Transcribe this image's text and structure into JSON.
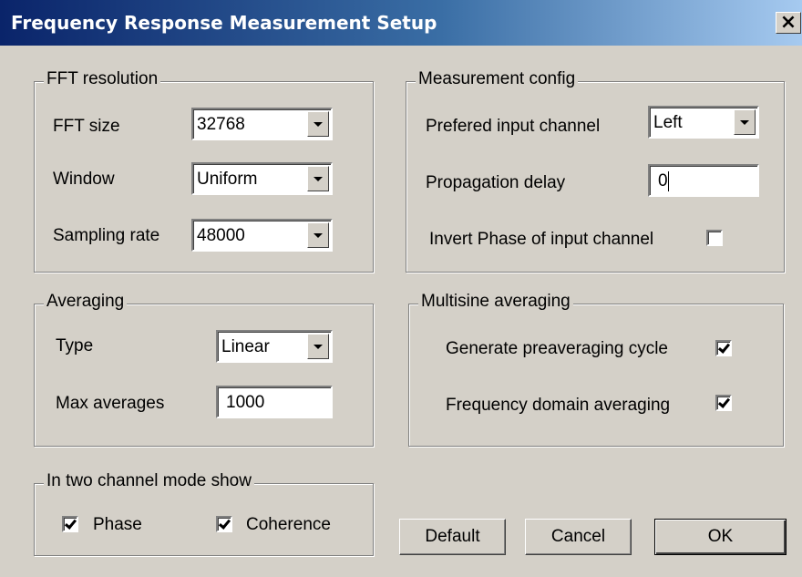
{
  "window": {
    "title": "Frequency Response Measurement Setup",
    "close_label": "×"
  },
  "fft": {
    "title": "FFT resolution",
    "fft_size_label": "FFT size",
    "fft_size_value": "32768",
    "window_label": "Window",
    "window_value": "Uniform",
    "sampling_label": "Sampling rate",
    "sampling_value": "48000"
  },
  "measurement": {
    "title": "Measurement config",
    "channel_label": "Prefered input channel",
    "channel_value": "Left",
    "delay_label": "Propagation delay",
    "delay_value": "0",
    "invert_label": "Invert Phase of input channel",
    "invert_checked": false
  },
  "averaging": {
    "title": "Averaging",
    "type_label": "Type",
    "type_value": "Linear",
    "max_label": "Max averages",
    "max_value": "1000"
  },
  "multisine": {
    "title": "Multisine averaging",
    "preavg_label": "Generate preaveraging cycle",
    "preavg_checked": true,
    "freqdomain_label": "Frequency domain averaging",
    "freqdomain_checked": true
  },
  "twochannel": {
    "title": "In two channel mode show",
    "phase_label": "Phase",
    "phase_checked": true,
    "coherence_label": "Coherence",
    "coherence_checked": true
  },
  "buttons": {
    "default_label": "Default",
    "cancel_label": "Cancel",
    "ok_label": "OK"
  },
  "colors": {
    "titlebar_start": "#0a246a",
    "titlebar_end": "#a6caf0",
    "face": "#d4d0c8"
  }
}
